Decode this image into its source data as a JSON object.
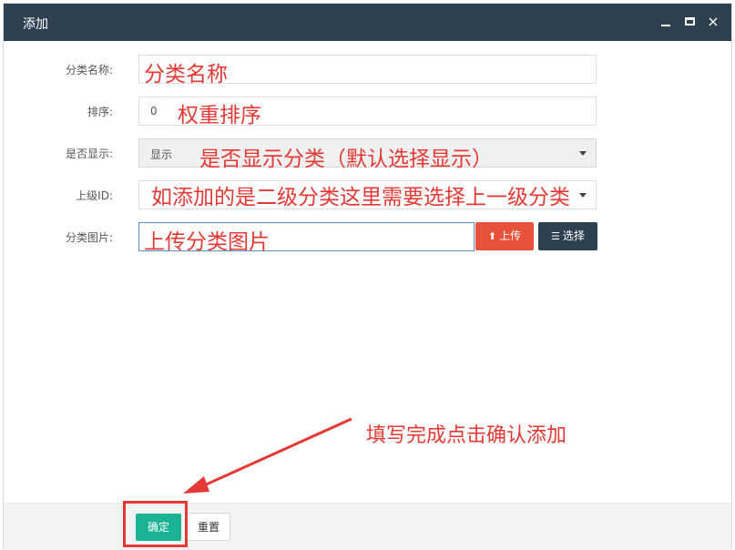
{
  "dialog": {
    "title": "添加",
    "controls": {
      "minimize": "minimize-icon",
      "maximize": "maximize-icon",
      "close": "×"
    }
  },
  "form": {
    "name": {
      "label": "分类名称:",
      "value": "",
      "annotation": "分类名称"
    },
    "sort": {
      "label": "排序:",
      "value": "0",
      "annotation": "权重排序"
    },
    "display": {
      "label": "是否显示:",
      "value": "显示",
      "annotation": "是否显示分类（默认选择显示）"
    },
    "parent": {
      "label": "上级ID:",
      "value": "",
      "annotation": "如添加的是二级分类这里需要选择上一级分类"
    },
    "image": {
      "label": "分类图片:",
      "value": "",
      "annotation": "上传分类图片",
      "upload_label": "上传",
      "choose_label": "选择"
    }
  },
  "footer": {
    "confirm_label": "确定",
    "reset_label": "重置",
    "instruction": "填写完成点击确认添加"
  },
  "colors": {
    "titlebar": "#2f4050",
    "annotation": "#e53935",
    "upload": "#e8513a",
    "confirm": "#1ab394"
  }
}
